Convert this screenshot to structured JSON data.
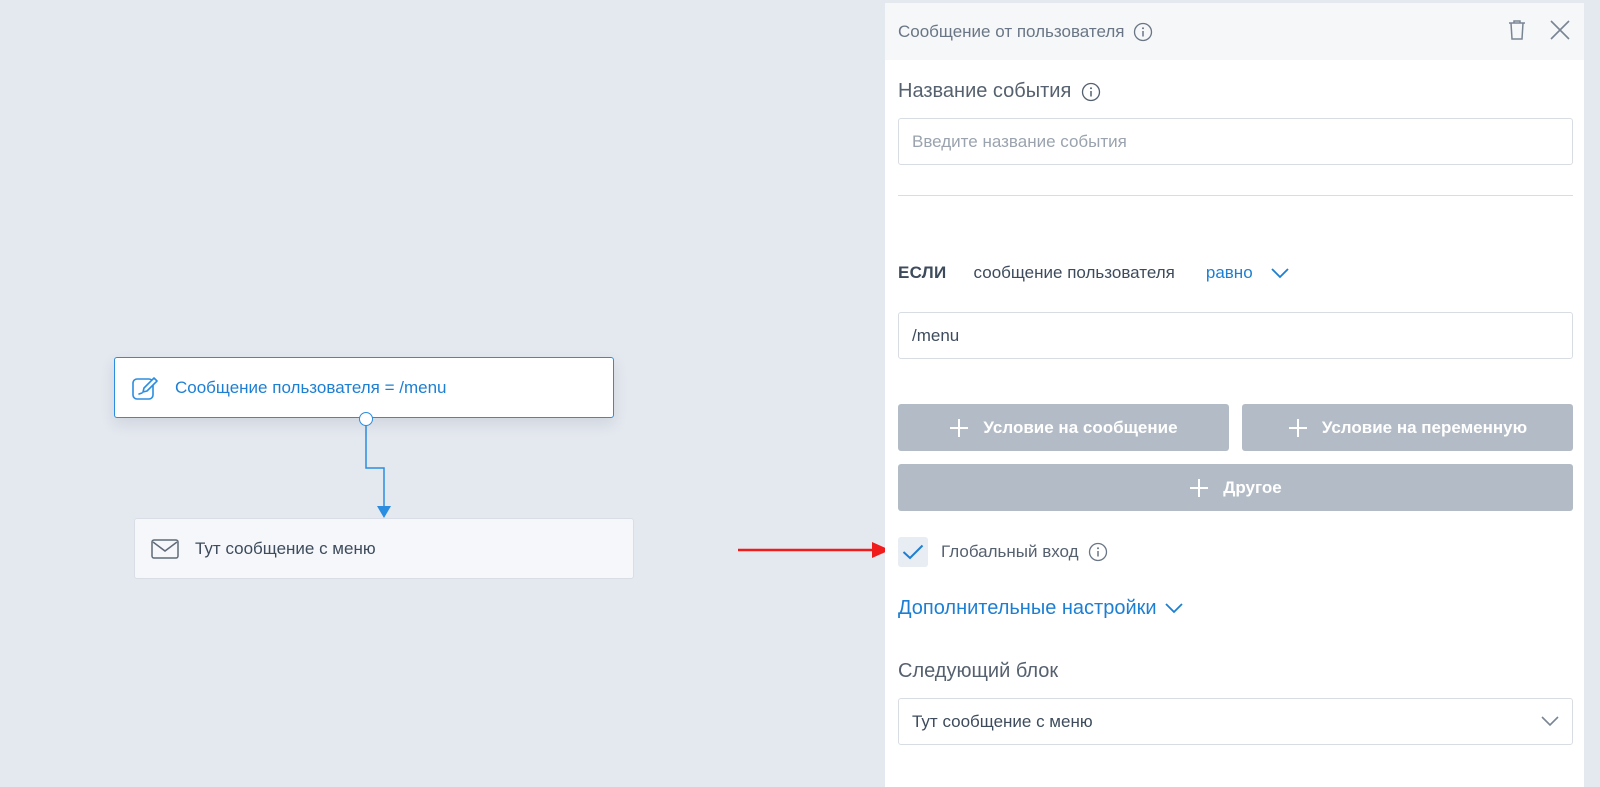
{
  "canvas": {
    "trigger_node": {
      "text": "Сообщение пользователя = /menu",
      "icon": "edit-icon"
    },
    "message_node": {
      "text": "Тут сообщение с меню",
      "icon": "envelope-icon"
    }
  },
  "panel": {
    "title": "Сообщение от пользователя",
    "event_name": {
      "label": "Название события",
      "placeholder": "Введите название события",
      "value": ""
    },
    "condition": {
      "if_label": "ЕСЛИ",
      "subject": "сообщение пользователя",
      "operator": "равно",
      "value": "/menu"
    },
    "buttons": {
      "message_condition": "Условие на сообщение",
      "variable_condition": "Условие на переменную",
      "other": "Другое"
    },
    "global_entry": {
      "label": "Глобальный вход",
      "checked": true
    },
    "advanced_settings": "Дополнительные настройки",
    "next_block": {
      "label": "Следующий блок",
      "value": "Тут сообщение с меню"
    }
  },
  "colors": {
    "accent": "#1d7fd3",
    "canvas_bg": "#e4e8ef",
    "button_gray": "#b3bcc6",
    "arrow_red": "#f01c1c"
  }
}
